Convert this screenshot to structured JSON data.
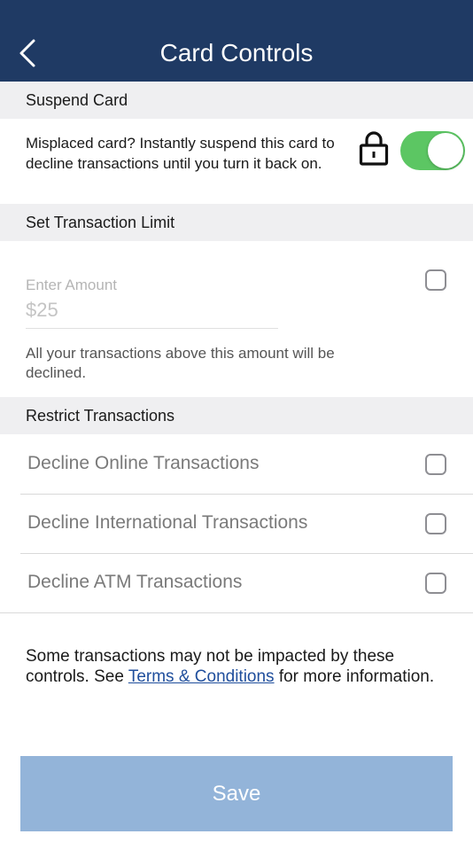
{
  "header": {
    "title": "Card Controls"
  },
  "suspend": {
    "section_title": "Suspend Card",
    "description": "Misplaced card? Instantly suspend this card to decline transactions until you turn it back on.",
    "toggle_on": true
  },
  "limit": {
    "section_title": "Set Transaction Limit",
    "field_label": "Enter Amount",
    "placeholder": "$25",
    "helper": "All your transactions above this amount will be declined."
  },
  "restrict": {
    "section_title": "Restrict Transactions",
    "items": [
      {
        "label": "Decline Online Transactions"
      },
      {
        "label": "Decline International Transactions"
      },
      {
        "label": "Decline ATM Transactions"
      }
    ]
  },
  "note": {
    "before": "Some transactions may not be impacted by these controls. See ",
    "link": "Terms & Conditions",
    "after": " for more information."
  },
  "save_label": "Save",
  "colors": {
    "header": "#1f3a64",
    "toggle_on": "#5cc663",
    "save_button": "#93b4d9",
    "link": "#1f4e9c"
  }
}
